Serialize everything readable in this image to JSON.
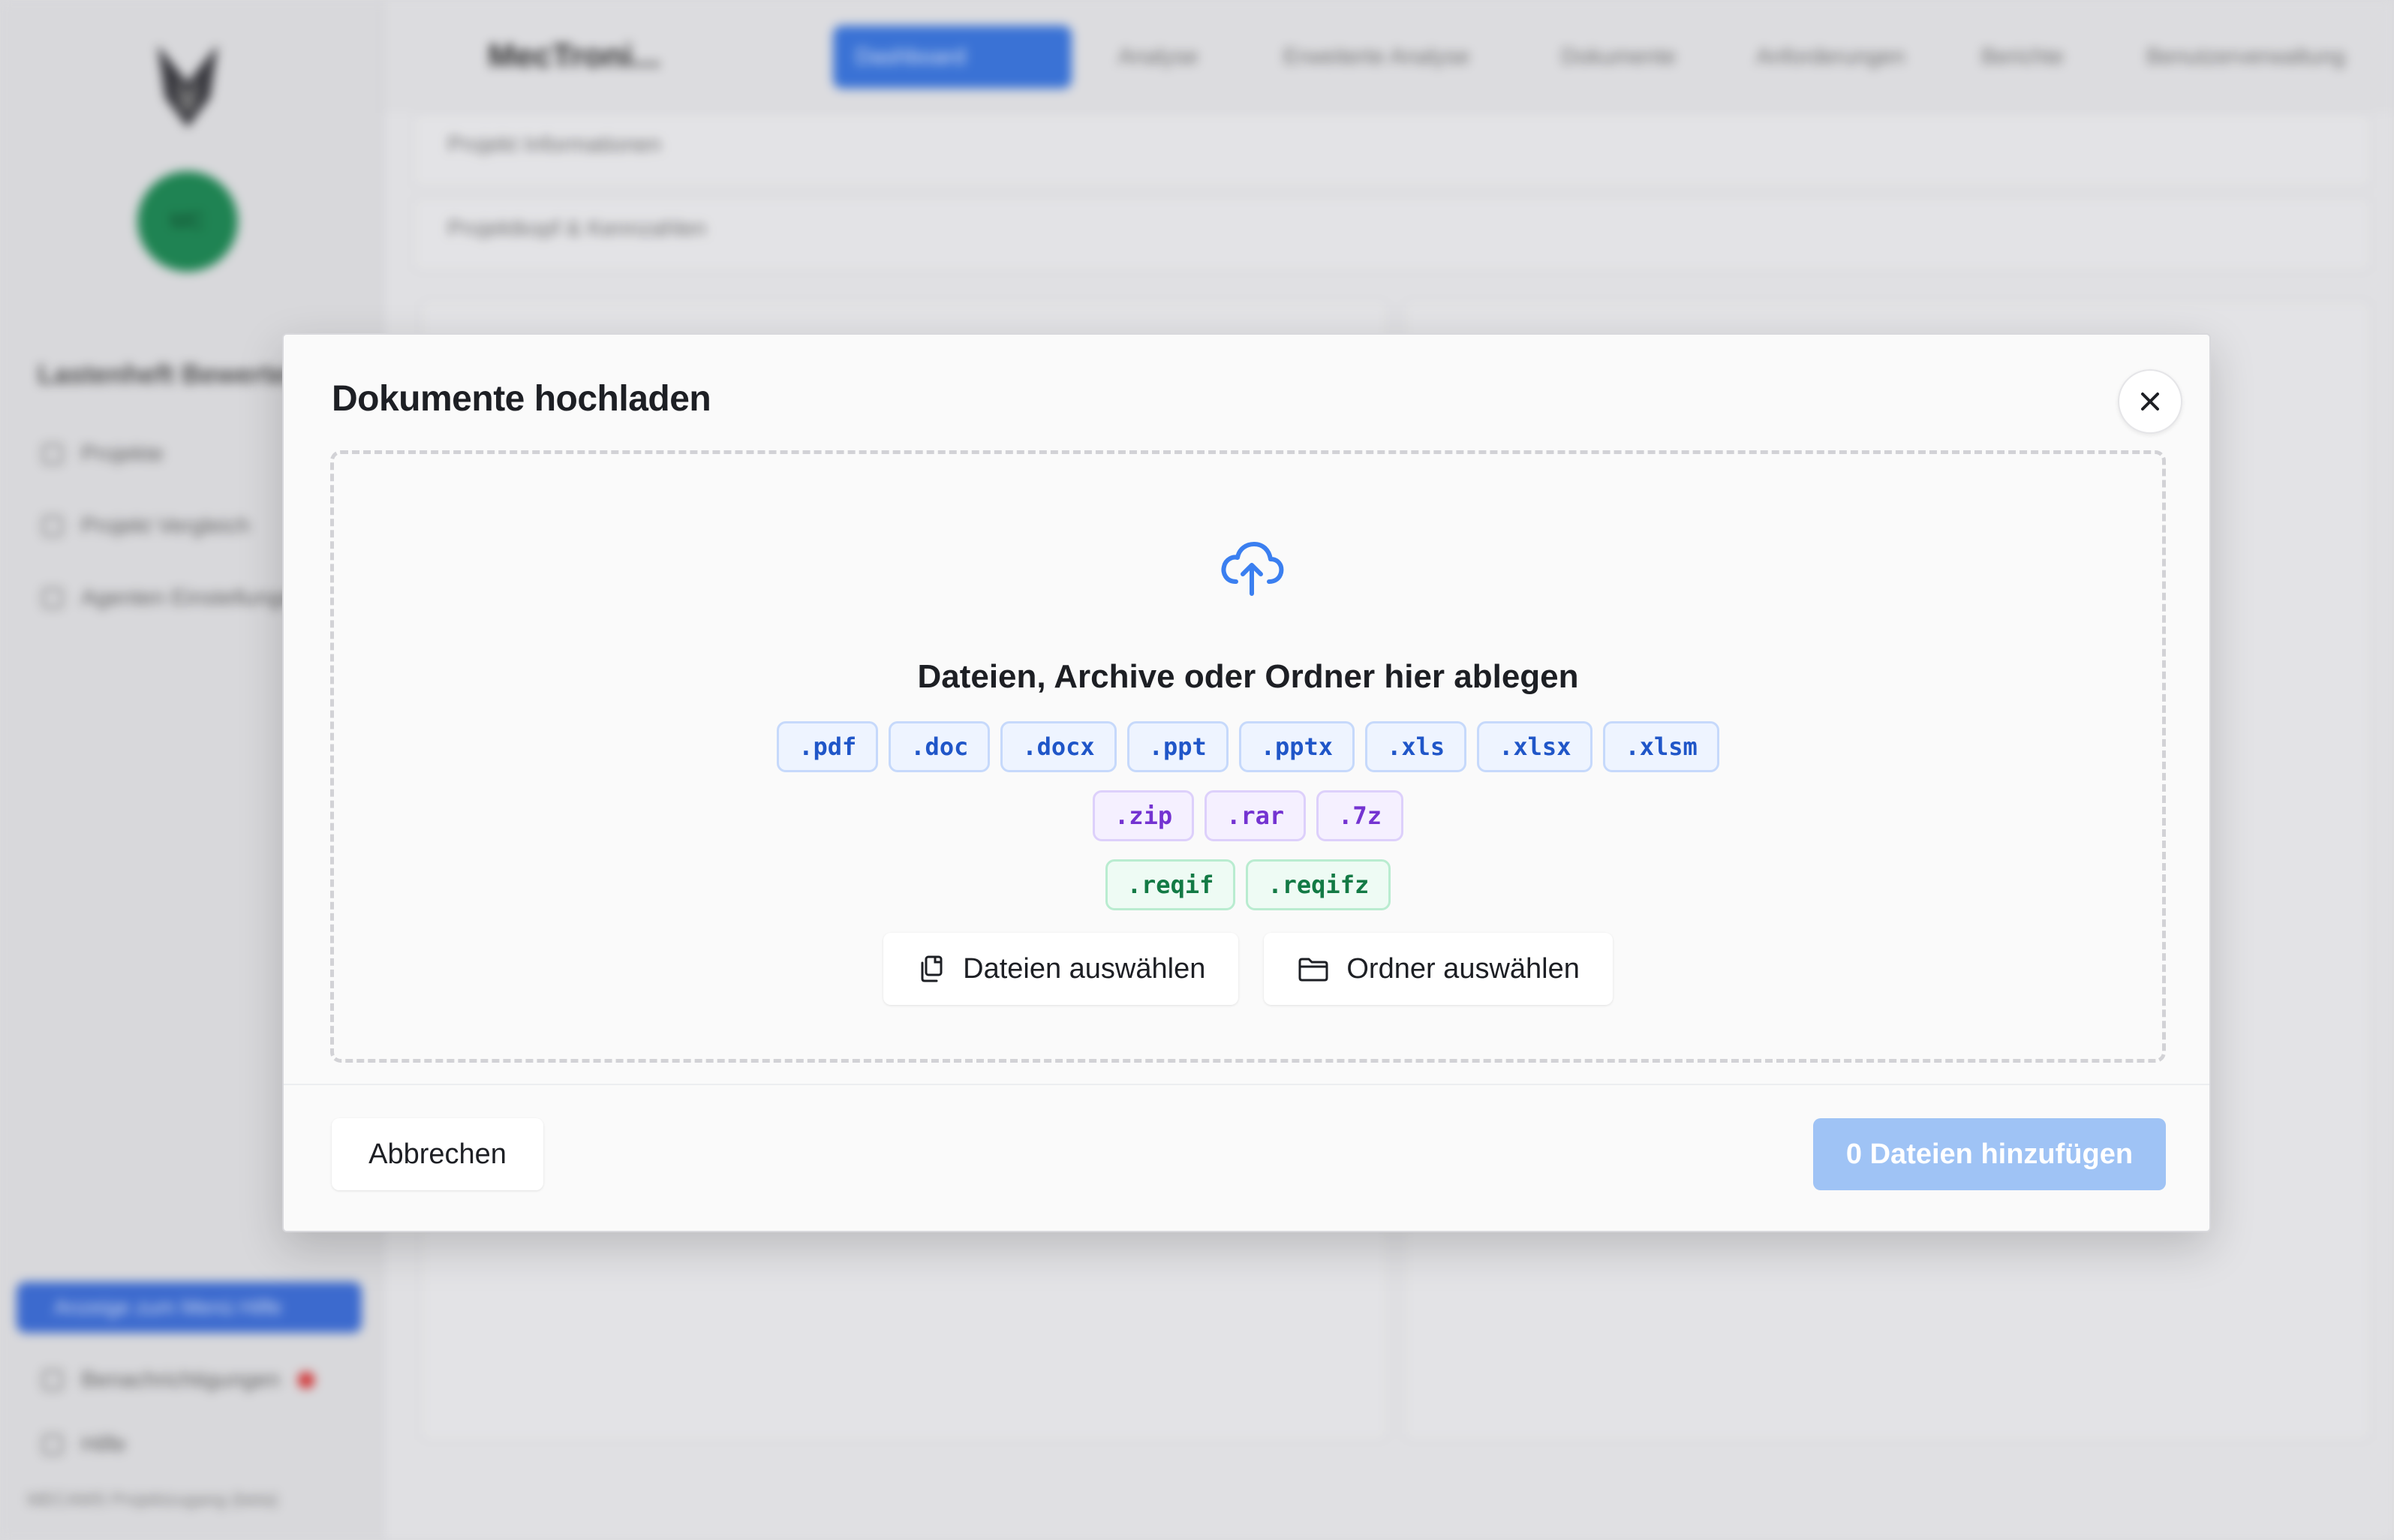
{
  "background": {
    "project_title": "MecTroni...",
    "tabs": [
      "Dashboard",
      "Analyse",
      "Erweiterte Analyse",
      "Dokumente",
      "Anforderungen",
      "Berichte",
      "Benutzerverwaltung"
    ],
    "active_tab": "Dashboard",
    "panels": [
      "Projekt Informationen",
      "Projektkopf & Kennzahlen"
    ],
    "sidebar": {
      "section_title": "Lastenheft Bewerten",
      "items": [
        "Projekte",
        "Projekt Vergleich",
        "Agenten Einstellungen"
      ],
      "primary_action": "Anzeige zum Menü Hilfe",
      "notifications": "Benachrichtigungen",
      "help": "Hilfe",
      "footer": "MECAMS Projektzugang (beta)"
    }
  },
  "modal": {
    "title": "Dokumente hochladen",
    "close_icon": "close-icon",
    "dropzone": {
      "icon": "cloud-upload-icon",
      "title": "Dateien, Archive oder Ordner hier ablegen",
      "document_types": [
        ".pdf",
        ".doc",
        ".docx",
        ".ppt",
        ".pptx",
        ".xls",
        ".xlsx",
        ".xlsm"
      ],
      "archive_types": [
        ".zip",
        ".rar",
        ".7z"
      ],
      "reqif_types": [
        ".reqif",
        ".reqifz"
      ],
      "select_files_label": "Dateien auswählen",
      "select_files_icon": "files-icon",
      "select_folder_label": "Ordner auswählen",
      "select_folder_icon": "folder-icon"
    },
    "cancel_label": "Abbrechen",
    "add_files_label": "0 Dateien hinzufügen"
  },
  "colors": {
    "accent": "#3c78e0",
    "add_button_disabled": "#9fc3f5",
    "chip_doc": "#2056c8",
    "chip_archive": "#7433d1",
    "chip_reqif": "#137a45"
  }
}
